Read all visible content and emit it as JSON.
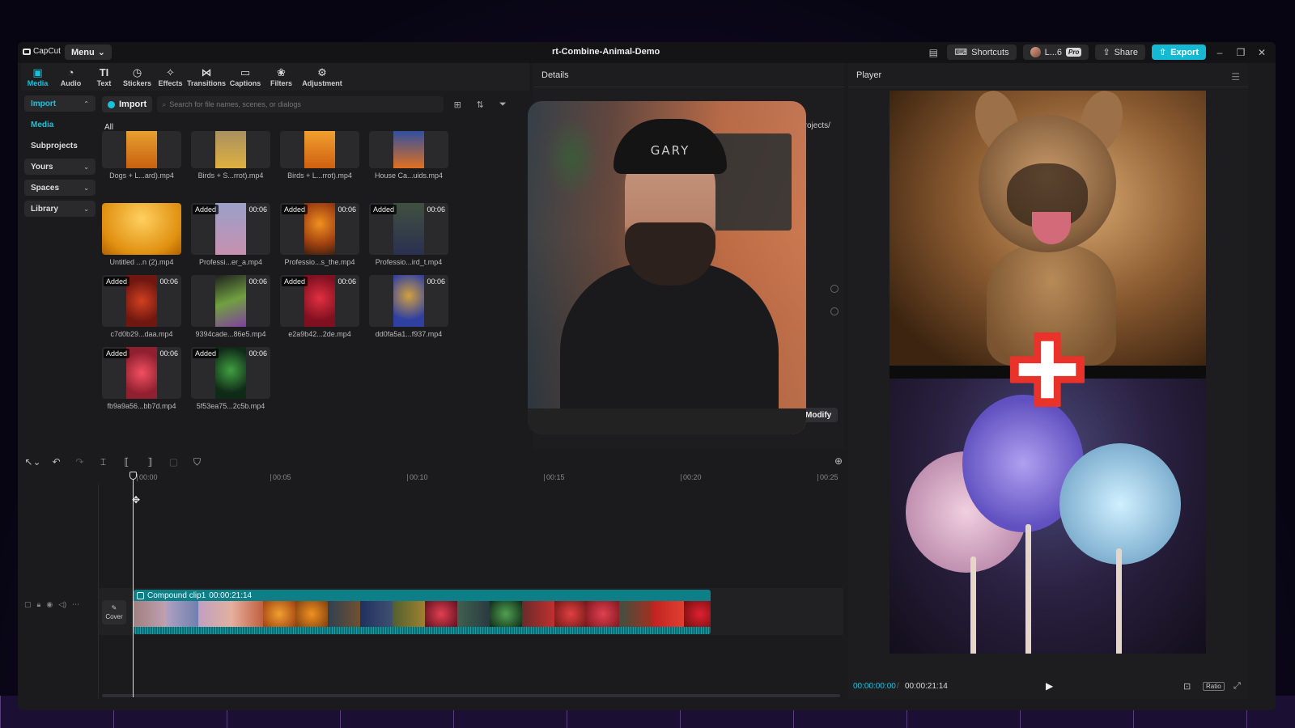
{
  "app": {
    "logo": "CapCut",
    "menu_label": "Menu",
    "project_title": "rt-Combine-Animal-Demo"
  },
  "titlebar": {
    "shortcuts_label": "Shortcuts",
    "user_label": "L...6",
    "pro_badge": "Pro",
    "share_label": "Share",
    "export_label": "Export"
  },
  "toolbar": {
    "tools": [
      {
        "label": "Media",
        "icon": "media-icon"
      },
      {
        "label": "Audio",
        "icon": "audio-icon"
      },
      {
        "label": "Text",
        "icon": "text-icon"
      },
      {
        "label": "Stickers",
        "icon": "stickers-icon"
      },
      {
        "label": "Effects",
        "icon": "effects-icon"
      },
      {
        "label": "Transitions",
        "icon": "transitions-icon"
      },
      {
        "label": "Captions",
        "icon": "captions-icon"
      },
      {
        "label": "Filters",
        "icon": "filters-icon"
      },
      {
        "label": "Adjustment",
        "icon": "adjustment-icon"
      }
    ],
    "active": "Media"
  },
  "leftnav": {
    "import": "Import",
    "media": "Media",
    "subprojects": "Subprojects",
    "yours": "Yours",
    "spaces": "Spaces",
    "library": "Library"
  },
  "media": {
    "import_label": "Import",
    "search_placeholder": "Search for file names, scenes, or dialogs",
    "filter_all": "All",
    "items": [
      {
        "name": "Dogs + L...ard).mp4",
        "added": "",
        "duration": ""
      },
      {
        "name": "Birds + S...rrot).mp4",
        "added": "",
        "duration": ""
      },
      {
        "name": "Birds + L...rrot).mp4",
        "added": "",
        "duration": ""
      },
      {
        "name": "House Ca...uids.mp4",
        "added": "",
        "duration": ""
      },
      {
        "name": "Untitled ...n (2).mp4",
        "added": "",
        "duration": ""
      },
      {
        "name": "Professi...er_a.mp4",
        "added": "Added",
        "duration": "00:06"
      },
      {
        "name": "Professio...s_the.mp4",
        "added": "Added",
        "duration": "00:06"
      },
      {
        "name": "Professio...ird_t.mp4",
        "added": "Added",
        "duration": "00:06"
      },
      {
        "name": "c7d0b29...daa.mp4",
        "added": "Added",
        "duration": "00:06"
      },
      {
        "name": "9394cade...86e5.mp4",
        "added": "",
        "duration": "00:06"
      },
      {
        "name": "e2a9b42...2de.mp4",
        "added": "Added",
        "duration": "00:06"
      },
      {
        "name": "dd0fa5a1...f937.mp4",
        "added": "",
        "duration": "00:06"
      },
      {
        "name": "fb9a9a56...bb7d.mp4",
        "added": "Added",
        "duration": "00:06"
      },
      {
        "name": "5f53ea75...2c5b.mp4",
        "added": "Added",
        "duration": "00:06"
      }
    ]
  },
  "details": {
    "title": "Details",
    "path": "Projects/",
    "modify_label": "Modify",
    "cap_text": "GARY"
  },
  "player": {
    "title": "Player",
    "time_current": "00:00:00:00",
    "time_sep": "/",
    "time_total": "00:00:21:14",
    "ratio_label": "Ratio"
  },
  "timeline": {
    "ticks": [
      "00:00",
      "00:05",
      "00:10",
      "00:15",
      "00:20",
      "00:25"
    ],
    "clip_name": "Compound clip1",
    "clip_duration": "00:00:21:14",
    "cover_label": "Cover"
  }
}
